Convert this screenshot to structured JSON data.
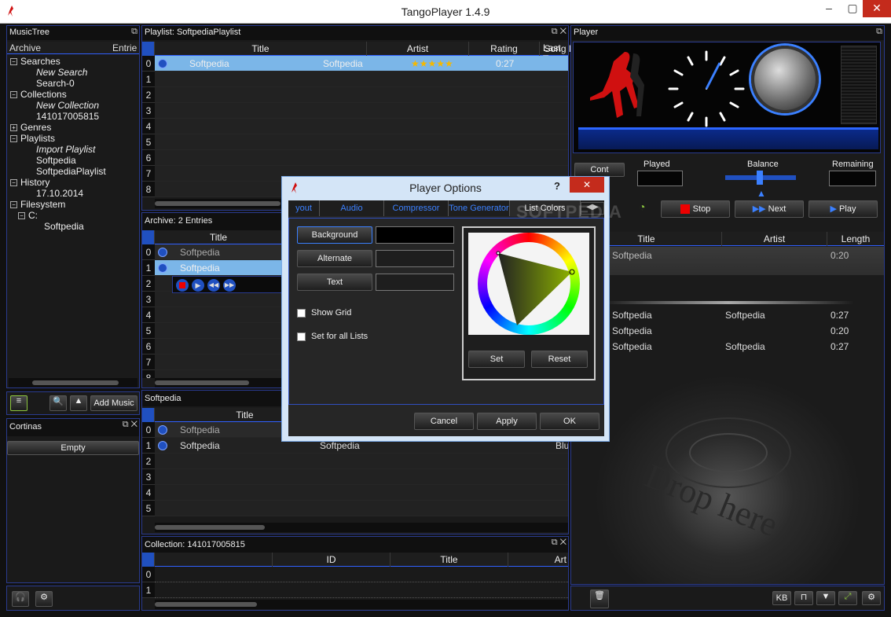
{
  "app": {
    "title": "TangoPlayer 1.4.9"
  },
  "musictree": {
    "title": "MusicTree",
    "col_archive": "Archive",
    "col_entries": "Entrie",
    "items": [
      {
        "label": "Searches",
        "indent": 0,
        "exp": "minus",
        "italic": false
      },
      {
        "label": "New Search",
        "indent": 2,
        "exp": "",
        "italic": true
      },
      {
        "label": "Search-0",
        "indent": 2,
        "exp": "",
        "italic": false
      },
      {
        "label": "Collections",
        "indent": 0,
        "exp": "minus",
        "italic": false
      },
      {
        "label": "New Collection",
        "indent": 2,
        "exp": "",
        "italic": true
      },
      {
        "label": "141017005815",
        "indent": 2,
        "exp": "",
        "italic": false
      },
      {
        "label": "Genres",
        "indent": 0,
        "exp": "plus",
        "italic": false
      },
      {
        "label": "Playlists",
        "indent": 0,
        "exp": "minus",
        "italic": false
      },
      {
        "label": "Import Playlist",
        "indent": 2,
        "exp": "",
        "italic": true
      },
      {
        "label": "Softpedia",
        "indent": 2,
        "exp": "",
        "italic": false
      },
      {
        "label": "SoftpediaPlaylist",
        "indent": 2,
        "exp": "",
        "italic": false
      },
      {
        "label": "History",
        "indent": 0,
        "exp": "minus",
        "italic": false
      },
      {
        "label": "17.10.2014",
        "indent": 2,
        "exp": "",
        "italic": false
      },
      {
        "label": "Filesystem",
        "indent": 0,
        "exp": "minus",
        "italic": false
      },
      {
        "label": "C:",
        "indent": 1,
        "exp": "minus",
        "italic": false
      },
      {
        "label": "Softpedia",
        "indent": 3,
        "exp": "",
        "italic": false
      }
    ],
    "add_music": "Add Music"
  },
  "cortinas": {
    "title": "Cortinas",
    "empty": "Empty"
  },
  "playlist": {
    "title": "Playlist: SoftpediaPlaylist",
    "headers": [
      "Title",
      "Artist",
      "Rating",
      "Song Length",
      "Last T"
    ],
    "rows": [
      {
        "num": "0",
        "title": "Softpedia",
        "artist": "Softpedia",
        "rating": "★★★★★",
        "length": "0:27"
      }
    ],
    "row_nums": [
      "0",
      "1",
      "2",
      "3",
      "4",
      "5",
      "6",
      "7",
      "8"
    ]
  },
  "archive": {
    "title": "Archive:  2  Entries",
    "header": "Title",
    "rows": [
      {
        "num": "0",
        "title": "Softpedia"
      },
      {
        "num": "1",
        "title": "Softpedia"
      }
    ],
    "row_nums": [
      "0",
      "1",
      "2",
      "3",
      "4",
      "5",
      "6",
      "7",
      "8"
    ]
  },
  "softpedia_list": {
    "title": "Softpedia",
    "header": "Title",
    "rows": [
      {
        "num": "0",
        "title": "Softpedia",
        "artist": "",
        "extra": ""
      },
      {
        "num": "1",
        "title": "Softpedia",
        "artist": "Softpedia",
        "extra": "Blu"
      }
    ],
    "row_nums": [
      "0",
      "1",
      "2",
      "3",
      "4",
      "5"
    ]
  },
  "collection": {
    "title": "Collection: 141017005815",
    "headers": [
      "ID",
      "Title",
      "Art"
    ],
    "row_nums": [
      "0",
      "1"
    ]
  },
  "player": {
    "title": "Player",
    "cont": "Cont",
    "played": "Played",
    "balance": "Balance",
    "remaining": "Remaining",
    "stop": "Stop",
    "next": "Next",
    "play": "Play",
    "queue_headers": [
      "Title",
      "Artist",
      "Length"
    ],
    "queue_current": {
      "title": "Softpedia",
      "length": "0:20"
    },
    "queue": [
      {
        "title": "Softpedia",
        "artist": "Softpedia",
        "length": "0:27"
      },
      {
        "title": "Softpedia",
        "artist": "",
        "length": "0:20"
      },
      {
        "title": "Softpedia",
        "artist": "Softpedia",
        "length": "0:27"
      }
    ],
    "drop_text": "Drop here",
    "kb": "KB"
  },
  "dialog": {
    "title": "Player Options",
    "help": "?",
    "tabs": [
      "yout",
      "Audio",
      "Compressor",
      "Tone Generator",
      "List Colors"
    ],
    "background": "Background",
    "alternate": "Alternate",
    "text": "Text",
    "show_grid": "Show Grid",
    "set_all": "Set for all Lists",
    "set": "Set",
    "reset": "Reset",
    "cancel": "Cancel",
    "apply": "Apply",
    "ok": "OK",
    "watermark": "SOFTPEDIA"
  },
  "colors": {
    "accent": "#3b80ff",
    "selection": "#7bb6e8",
    "panel_border": "#2a3b8f"
  }
}
